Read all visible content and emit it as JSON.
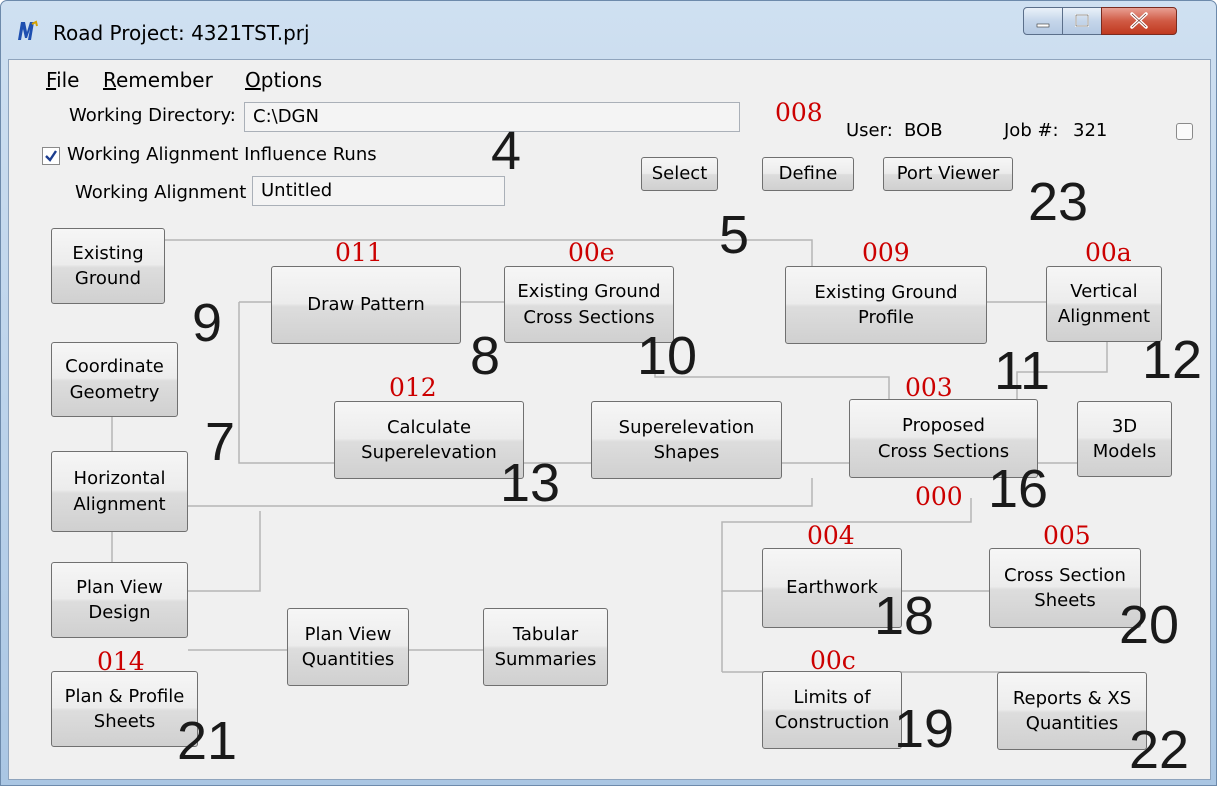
{
  "window": {
    "title": "Road Project: 4321TST.prj"
  },
  "menu": {
    "file": "File",
    "remember": "Remember",
    "options": "Options"
  },
  "header": {
    "working_directory_label": "Working Directory:",
    "working_directory_value": "C:\\DGN",
    "influence_runs_label": "Working Alignment Influence Runs",
    "influence_runs_checked": true,
    "working_alignment_label": "Working Alignment",
    "working_alignment_value": "Untitled",
    "user_label": "User:",
    "user_value": "BOB",
    "job_label": "Job #:",
    "job_value": "321",
    "select": "Select",
    "define": "Define",
    "port_viewer": "Port Viewer"
  },
  "nodes": {
    "existing_ground": [
      "Existing",
      "Ground"
    ],
    "coordinate_geometry": [
      "Coordinate",
      "Geometry"
    ],
    "horizontal_alignment": [
      "Horizontal",
      "Alignment"
    ],
    "plan_view_design": [
      "Plan View",
      "Design"
    ],
    "plan_profile_sheets": [
      "Plan & Profile",
      "Sheets"
    ],
    "draw_pattern": [
      "Draw Pattern"
    ],
    "existing_ground_xs": [
      "Existing Ground",
      "Cross Sections"
    ],
    "existing_ground_profile": [
      "Existing Ground",
      "Profile"
    ],
    "vertical_alignment": [
      "Vertical",
      "Alignment"
    ],
    "calculate_superelevation": [
      "Calculate",
      "Superelevation"
    ],
    "superelevation_shapes": [
      "Superelevation",
      "Shapes"
    ],
    "proposed_xs": [
      "Proposed",
      "Cross Sections"
    ],
    "models_3d": [
      "3D",
      "Models"
    ],
    "earthwork": [
      "Earthwork"
    ],
    "cross_section_sheets": [
      "Cross Section",
      "Sheets"
    ],
    "plan_view_quantities": [
      "Plan View",
      "Quantities"
    ],
    "tabular_summaries": [
      "Tabular",
      "Summaries"
    ],
    "limits_of_construction": [
      "Limits of",
      "Construction"
    ],
    "reports_xs_quantities": [
      "Reports & XS",
      "Quantities"
    ]
  },
  "red_codes": {
    "c008": "008",
    "c011": "011",
    "c00e": "00e",
    "c009": "009",
    "c00a": "00a",
    "c012": "012",
    "c003": "003",
    "c000": "000",
    "c004": "004",
    "c005": "005",
    "c014": "014",
    "c00c": "00c"
  },
  "annotations": {
    "n4": "4",
    "n5": "5",
    "n7": "7",
    "n8": "8",
    "n9": "9",
    "n10": "10",
    "n11": "11",
    "n12": "12",
    "n13": "13",
    "n16": "16",
    "n18": "18",
    "n19": "19",
    "n20": "20",
    "n21": "21",
    "n22": "22",
    "n23": "23"
  },
  "colors": {
    "code_red": "#cc0000",
    "title_bar": "#b9d1ea",
    "close_button": "#c0391f"
  }
}
